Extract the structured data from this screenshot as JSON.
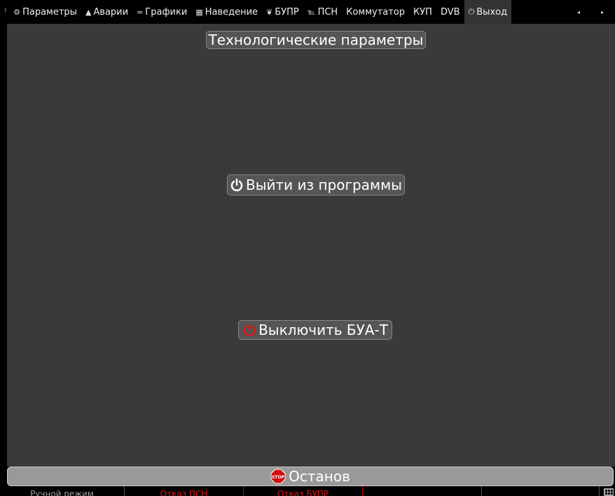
{
  "tabs": [
    {
      "id": "params",
      "icon": "⚙",
      "label": "Параметры"
    },
    {
      "id": "alarms",
      "icon": "▲",
      "label": "Аварии"
    },
    {
      "id": "graphs",
      "icon": "≈",
      "label": "Графики"
    },
    {
      "id": "guidance",
      "icon": "▦",
      "label": "Наведение"
    },
    {
      "id": "bupr",
      "icon": "❦",
      "label": "БУПР"
    },
    {
      "id": "psn",
      "icon": "℡",
      "label": "ПСН"
    },
    {
      "id": "switch",
      "icon": "",
      "label": "Коммутатор"
    },
    {
      "id": "kup",
      "icon": "",
      "label": "КУП"
    },
    {
      "id": "dvb",
      "icon": "",
      "label": "DVB"
    },
    {
      "id": "exit",
      "icon": "⏻",
      "label": "Выход",
      "active": true
    }
  ],
  "scroll": {
    "left": "◂",
    "right": "▸"
  },
  "main": {
    "title": "Технологические параметры",
    "exit_label": "Выйти из программы",
    "shutdown_label": "Выключить БУА-Т"
  },
  "stop": {
    "label": "Останов",
    "icon": "stop-sign-icon"
  },
  "status": [
    {
      "text": "Ручной режим",
      "color": "grey"
    },
    {
      "text": "Отказ ПСН",
      "color": "red"
    },
    {
      "text": "Отказ БУПР",
      "color": "red"
    },
    {
      "text": "",
      "color": "grey"
    },
    {
      "text": "",
      "color": "grey"
    }
  ],
  "colors": {
    "accent_red": "#e01515",
    "panel": "#3a3a3a",
    "button": "#555555"
  }
}
